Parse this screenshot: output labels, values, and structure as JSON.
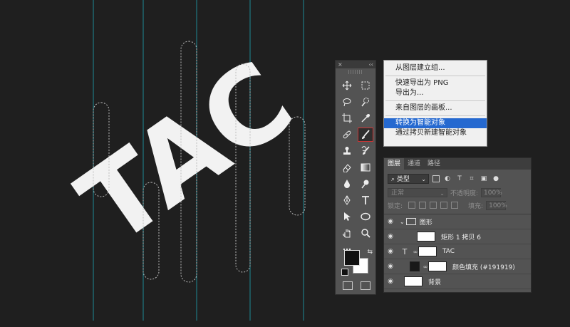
{
  "tools_panel": {
    "close_glyph": "×",
    "collapse_glyph": "‹‹"
  },
  "context_menu": {
    "items": [
      "从图层建立组...",
      "快速导出为 PNG",
      "导出为...",
      "来自图层的画板...",
      "转换为智能对象",
      "通过拷贝新建智能对象"
    ],
    "highlighted": "转换为智能对象"
  },
  "layers_panel": {
    "tabs": [
      "图层",
      "通道",
      "路径"
    ],
    "filter_label": "类型",
    "blend_mode": "正常",
    "opacity_label": "不透明度:",
    "opacity_value": "100%",
    "lock_label": "锁定:",
    "fill_label": "填充:",
    "fill_value": "100%",
    "layers": [
      {
        "name": "图形",
        "kind": "group"
      },
      {
        "name": "矩形 1 拷贝 6",
        "kind": "shape"
      },
      {
        "name": "TAC",
        "kind": "text"
      },
      {
        "name": "颜色填充 (#191919)",
        "kind": "fill"
      },
      {
        "name": "背景",
        "kind": "background"
      }
    ]
  },
  "canvas": {
    "artwork_text": "TAC",
    "background_color": "#1f1f1f",
    "letter_color": "#f2f2f2",
    "guide_color": "#1e8a96"
  }
}
